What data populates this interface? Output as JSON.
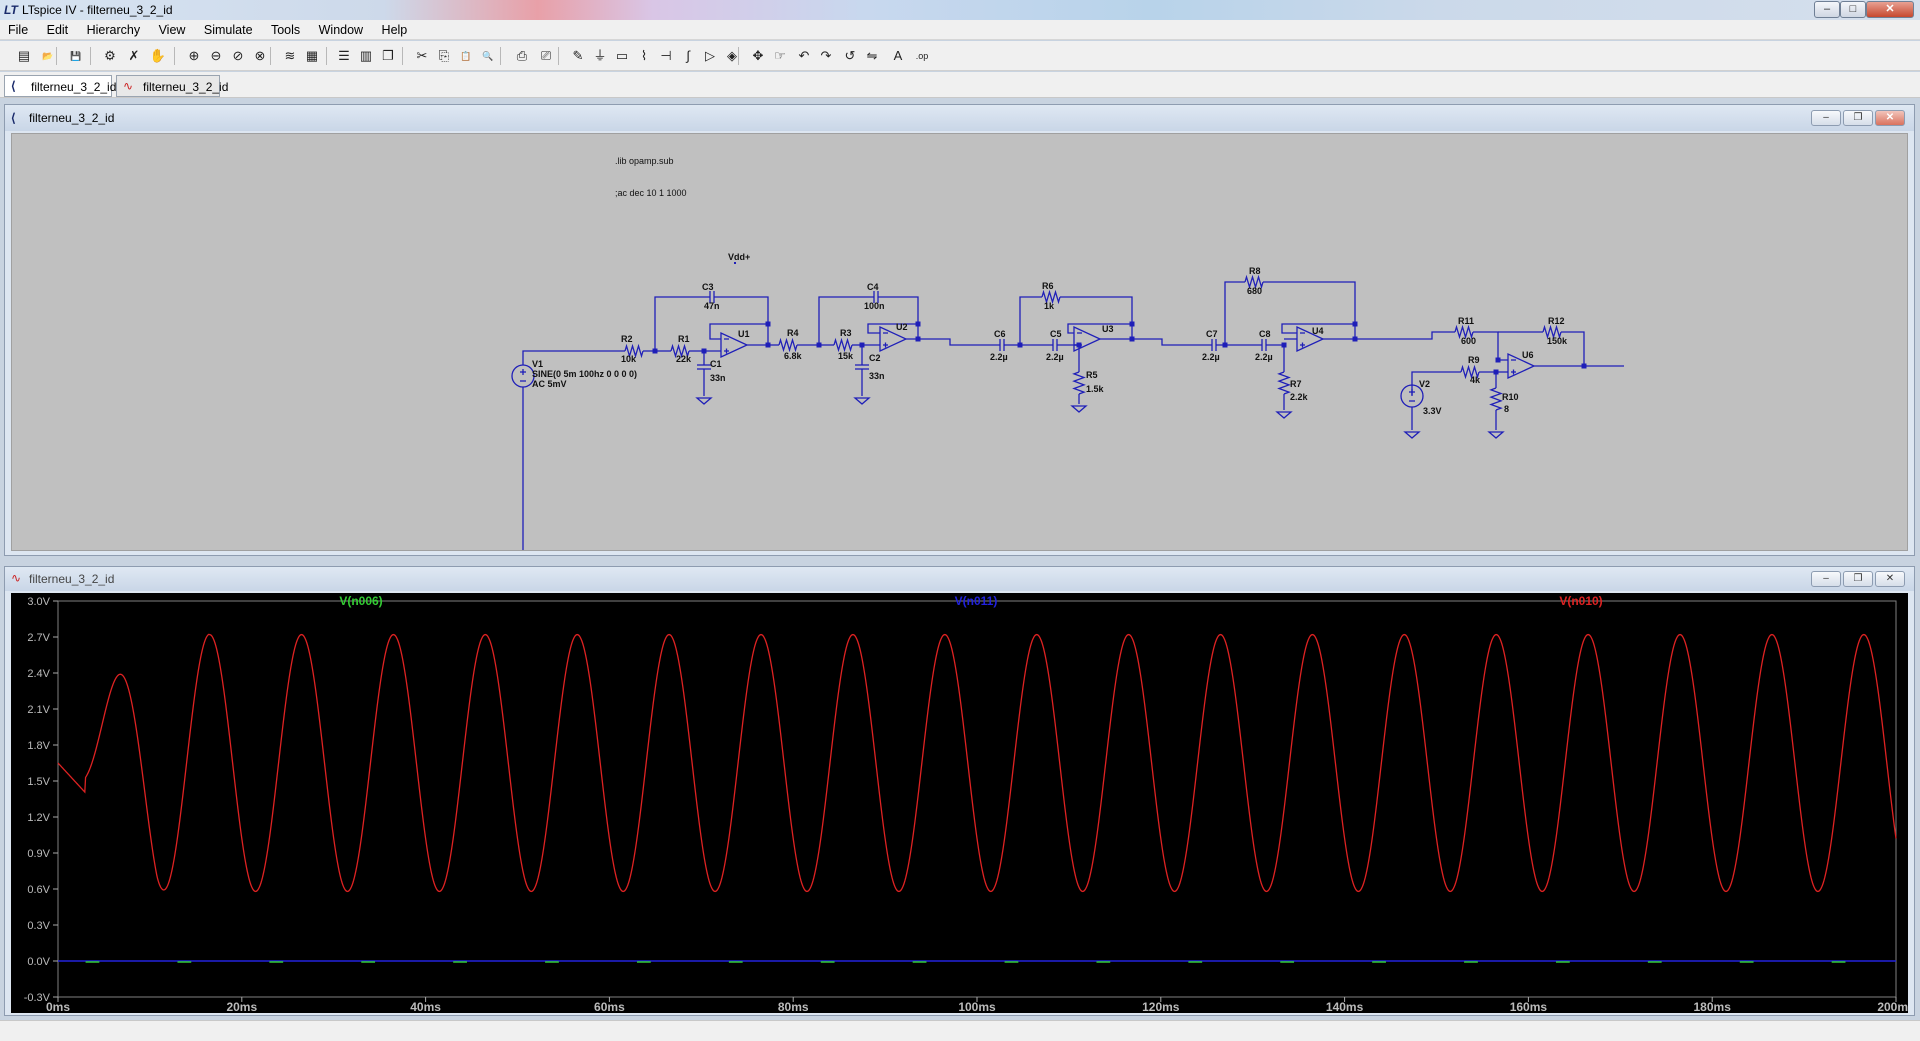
{
  "window": {
    "title": "LTspice IV - filterneu_3_2_id",
    "buttons": {
      "minimize": "–",
      "maximize": "□",
      "close": "✕"
    }
  },
  "menu": [
    "File",
    "Edit",
    "Hierarchy",
    "View",
    "Simulate",
    "Tools",
    "Window",
    "Help"
  ],
  "toolbar_icons": [
    "new-schematic-icon",
    "open-icon",
    "save-icon",
    "control-panel-icon",
    "run-icon",
    "halt-icon",
    "zoom-in-icon",
    "zoom-out-icon",
    "zoom-back-icon",
    "zoom-fit-icon",
    "autorange-icon",
    "grid-icon",
    "tile-horizontal-icon",
    "tile-vertical-icon",
    "cascade-icon",
    "cut-icon",
    "copy-icon",
    "paste-icon",
    "find-icon",
    "print-icon",
    "print-preview-icon",
    "draw-wire-icon",
    "ground-icon",
    "label-net-icon",
    "resistor-icon",
    "capacitor-icon",
    "inductor-icon",
    "diode-icon",
    "component-icon",
    "move-icon",
    "drag-icon",
    "undo-icon",
    "redo-icon",
    "rotate-icon",
    "mirror-icon",
    "text-icon",
    "spice-directive-icon"
  ],
  "tabs": [
    {
      "label": "filterneu_3_2_id",
      "icon": "schematic-icon"
    },
    {
      "label": "filterneu_3_2_id",
      "icon": "waveform-icon"
    }
  ],
  "schematic": {
    "title": "filterneu_3_2_id",
    "directives": [
      ".lib opamp.sub",
      ";ac dec 10 1 1000"
    ],
    "vdd_label": "Vdd+",
    "components": [
      {
        "ref": "V1",
        "value": "SINE(0 5m 100hz 0 0 0 0)",
        "extra": "AC 5mV"
      },
      {
        "ref": "R2",
        "value": "10k"
      },
      {
        "ref": "R1",
        "value": "22k"
      },
      {
        "ref": "C3",
        "value": "47n"
      },
      {
        "ref": "C1",
        "value": "33n"
      },
      {
        "ref": "U1",
        "value": ""
      },
      {
        "ref": "R4",
        "value": "6.8k"
      },
      {
        "ref": "R3",
        "value": "15k"
      },
      {
        "ref": "C4",
        "value": "100n"
      },
      {
        "ref": "C2",
        "value": "33n"
      },
      {
        "ref": "U2",
        "value": ""
      },
      {
        "ref": "C6",
        "value": "2.2µ"
      },
      {
        "ref": "C5",
        "value": "2.2µ"
      },
      {
        "ref": "R6",
        "value": "1k"
      },
      {
        "ref": "R5",
        "value": "1.5k"
      },
      {
        "ref": "U3",
        "value": ""
      },
      {
        "ref": "C7",
        "value": "2.2µ"
      },
      {
        "ref": "C8",
        "value": "2.2µ"
      },
      {
        "ref": "R8",
        "value": "680"
      },
      {
        "ref": "R7",
        "value": "2.2k"
      },
      {
        "ref": "U4",
        "value": ""
      },
      {
        "ref": "R11",
        "value": "600"
      },
      {
        "ref": "R12",
        "value": "150k"
      },
      {
        "ref": "R9",
        "value": "4k"
      },
      {
        "ref": "R10",
        "value": "8"
      },
      {
        "ref": "V2",
        "value": "3.3V"
      },
      {
        "ref": "U6",
        "value": ""
      }
    ]
  },
  "waveform": {
    "title": "filterneu_3_2_id",
    "legend": [
      {
        "name": "V(n006)",
        "color": "#33cc33"
      },
      {
        "name": "V(n011)",
        "color": "#2222dd"
      },
      {
        "name": "V(n010)",
        "color": "#dd2222"
      }
    ],
    "y_ticks": [
      "3.0V",
      "2.7V",
      "2.4V",
      "2.1V",
      "1.8V",
      "1.5V",
      "1.2V",
      "0.9V",
      "0.6V",
      "0.3V",
      "0.0V",
      "-0.3V"
    ],
    "x_ticks": [
      "0ms",
      "20ms",
      "40ms",
      "60ms",
      "80ms",
      "100ms",
      "120ms",
      "140ms",
      "160ms",
      "180ms",
      "200ms"
    ]
  },
  "chart_data": {
    "type": "line",
    "xlabel": "",
    "ylabel": "",
    "xlim": [
      0,
      200
    ],
    "ylim": [
      -0.3,
      3.0
    ],
    "grid": false,
    "legend": "top",
    "series": [
      {
        "name": "V(n010)",
        "color": "#dd2222",
        "frequency_hz": 100,
        "offset_v": 1.65,
        "amplitude_v": 1.07,
        "x": [
          0,
          2,
          3,
          6.5,
          11.5,
          16.5,
          21.5,
          26.5,
          31.5,
          36.5,
          41.5,
          46.5,
          51.5,
          56.5,
          61.5,
          66.5,
          71.5,
          76.5,
          81.5,
          86.5,
          91.5,
          96.5,
          101.5,
          106.5,
          111.5,
          116.5,
          121.5,
          126.5,
          131.5,
          136.5,
          141.5,
          146.5,
          151.5,
          156.5,
          161.5,
          166.5,
          171.5,
          176.5,
          181.5,
          186.5,
          191.5,
          196.5,
          200
        ],
        "y": [
          1.65,
          1.55,
          1.4,
          2.35,
          0.6,
          2.78,
          0.58,
          2.72,
          0.58,
          2.72,
          0.58,
          2.72,
          0.58,
          2.72,
          0.58,
          2.72,
          0.58,
          2.72,
          0.58,
          2.72,
          0.58,
          2.72,
          0.58,
          2.72,
          0.58,
          2.72,
          0.58,
          2.72,
          0.58,
          2.72,
          0.58,
          2.72,
          0.58,
          2.72,
          0.58,
          2.72,
          0.58,
          2.72,
          0.58,
          2.72,
          0.58,
          2.72,
          1.1
        ]
      },
      {
        "name": "V(n011)",
        "color": "#2222dd",
        "x": [
          0,
          200
        ],
        "y": [
          0.0,
          0.0
        ]
      },
      {
        "name": "V(n006)",
        "color": "#33cc33",
        "x": [
          0,
          200
        ],
        "y": [
          0.0,
          0.0
        ]
      }
    ]
  }
}
